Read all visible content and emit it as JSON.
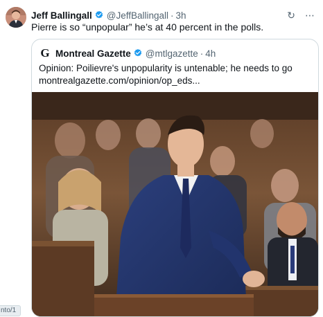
{
  "tweet": {
    "author_name": "Jeff Ballingall",
    "author_handle": "@JeffBallingall",
    "separator": "·",
    "time": "3h",
    "text": "Pierre is so “unpopular” he’s at 40 percent in the polls.",
    "more_icon": "⋯",
    "grok_icon": "↻"
  },
  "quoted": {
    "logo_letter": "G",
    "author_name": "Montreal Gazette",
    "author_handle": "@mtlgazette",
    "separator": "·",
    "time": "4h",
    "text": "Opinion: Poilievre's unpopularity is untenable; he needs to go",
    "link": "montrealgazette.com/opinion/op_eds..."
  },
  "colors": {
    "verified": "#1d9bf0",
    "text": "#0f1419",
    "muted": "#536471",
    "border": "#cfd9de"
  },
  "bottom_tag": "nto/1"
}
